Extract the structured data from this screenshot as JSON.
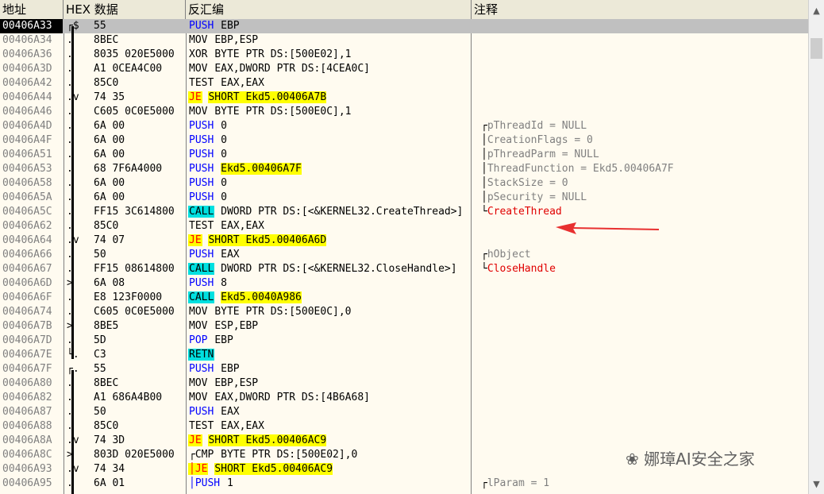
{
  "columns": {
    "address": "地址",
    "hex": "HEX 数据",
    "disassembly": "反汇编",
    "comment": "注释"
  },
  "rows": [
    {
      "addr": "00406A33",
      "mark": "┌$",
      "hex": "55",
      "type": "push",
      "mn": "PUSH",
      "args": "EBP",
      "comment": "",
      "selected": true
    },
    {
      "addr": "00406A34",
      "mark": ".",
      "hex": "8BEC",
      "type": "plain",
      "mn": "MOV",
      "args": "EBP,ESP",
      "comment": ""
    },
    {
      "addr": "00406A36",
      "mark": ".",
      "hex": "8035 020E5000",
      "type": "plain",
      "mn": "XOR",
      "args": "BYTE PTR DS:[500E02],1",
      "comment": ""
    },
    {
      "addr": "00406A3D",
      "mark": ".",
      "hex": "A1 0CEA4C00",
      "type": "plain",
      "mn": "MOV",
      "args": "EAX,DWORD PTR DS:[4CEA0C]",
      "comment": ""
    },
    {
      "addr": "00406A42",
      "mark": ".",
      "hex": "85C0",
      "type": "plain",
      "mn": "TEST",
      "args": "EAX,EAX",
      "comment": ""
    },
    {
      "addr": "00406A44",
      "mark": ".v",
      "hex": "74 35",
      "type": "jcc",
      "mn": "JE",
      "args": "SHORT Ekd5.00406A7B",
      "comment": ""
    },
    {
      "addr": "00406A46",
      "mark": ".",
      "hex": "C605 0C0E5000",
      "type": "plain",
      "mn": "MOV",
      "args": "BYTE PTR DS:[500E0C],1",
      "comment": ""
    },
    {
      "addr": "00406A4D",
      "mark": ".",
      "hex": "6A 00",
      "type": "push",
      "mn": "PUSH",
      "args": "0",
      "comment": "pThreadId = NULL",
      "cb": "┌"
    },
    {
      "addr": "00406A4F",
      "mark": ".",
      "hex": "6A 00",
      "type": "push",
      "mn": "PUSH",
      "args": "0",
      "comment": "CreationFlags = 0",
      "cb": "│"
    },
    {
      "addr": "00406A51",
      "mark": ".",
      "hex": "6A 00",
      "type": "push",
      "mn": "PUSH",
      "args": "0",
      "comment": "pThreadParm = NULL",
      "cb": "│"
    },
    {
      "addr": "00406A53",
      "mark": ".",
      "hex": "68 7F6A4000",
      "type": "push",
      "mn": "PUSH",
      "args": "Ekd5.00406A7F",
      "hlArgs": true,
      "comment": "ThreadFunction = Ekd5.00406A7F",
      "cb": "│"
    },
    {
      "addr": "00406A58",
      "mark": ".",
      "hex": "6A 00",
      "type": "push",
      "mn": "PUSH",
      "args": "0",
      "comment": "StackSize = 0",
      "cb": "│"
    },
    {
      "addr": "00406A5A",
      "mark": ".",
      "hex": "6A 00",
      "type": "push",
      "mn": "PUSH",
      "args": "0",
      "comment": "pSecurity = NULL",
      "cb": "│"
    },
    {
      "addr": "00406A5C",
      "mark": ".",
      "hex": "FF15 3C614800",
      "type": "call",
      "mn": "CALL",
      "args": "DWORD PTR DS:[<&KERNEL32.CreateThread>]",
      "comment": "CreateThread",
      "red": true,
      "cb": "└"
    },
    {
      "addr": "00406A62",
      "mark": ".",
      "hex": "85C0",
      "type": "plain",
      "mn": "TEST",
      "args": "EAX,EAX",
      "comment": ""
    },
    {
      "addr": "00406A64",
      "mark": ".v",
      "hex": "74 07",
      "type": "jcc",
      "mn": "JE",
      "args": "SHORT Ekd5.00406A6D",
      "comment": ""
    },
    {
      "addr": "00406A66",
      "mark": ".",
      "hex": "50",
      "type": "push",
      "mn": "PUSH",
      "args": "EAX",
      "comment": "hObject",
      "cb": "┌"
    },
    {
      "addr": "00406A67",
      "mark": ".",
      "hex": "FF15 08614800",
      "type": "call",
      "mn": "CALL",
      "args": "DWORD PTR DS:[<&KERNEL32.CloseHandle>]",
      "comment": "CloseHandle",
      "red": true,
      "cb": "└"
    },
    {
      "addr": "00406A6D",
      "mark": ">",
      "hex": "6A 08",
      "type": "push",
      "mn": "PUSH",
      "args": "8",
      "comment": ""
    },
    {
      "addr": "00406A6F",
      "mark": ".",
      "hex": "E8 123F0000",
      "type": "call",
      "mn": "CALL",
      "args": "Ekd5.0040A986",
      "hlArgs": true,
      "comment": ""
    },
    {
      "addr": "00406A74",
      "mark": ".",
      "hex": "C605 0C0E5000",
      "type": "plain",
      "mn": "MOV",
      "args": "BYTE PTR DS:[500E0C],0",
      "comment": ""
    },
    {
      "addr": "00406A7B",
      "mark": ">",
      "hex": "8BE5",
      "type": "plain",
      "mn": "MOV",
      "args": "ESP,EBP",
      "comment": ""
    },
    {
      "addr": "00406A7D",
      "mark": ".",
      "hex": "5D",
      "type": "pop",
      "mn": "POP",
      "args": "EBP",
      "comment": ""
    },
    {
      "addr": "00406A7E",
      "mark": "└.",
      "hex": "C3",
      "type": "retn",
      "mn": "RETN",
      "args": "",
      "comment": ""
    },
    {
      "addr": "00406A7F",
      "mark": "┌.",
      "hex": "55",
      "type": "push",
      "mn": "PUSH",
      "args": "EBP",
      "comment": ""
    },
    {
      "addr": "00406A80",
      "mark": ".",
      "hex": "8BEC",
      "type": "plain",
      "mn": "MOV",
      "args": "EBP,ESP",
      "comment": ""
    },
    {
      "addr": "00406A82",
      "mark": ".",
      "hex": "A1 686A4B00",
      "type": "plain",
      "mn": "MOV",
      "args": "EAX,DWORD PTR DS:[4B6A68]",
      "comment": ""
    },
    {
      "addr": "00406A87",
      "mark": ".",
      "hex": "50",
      "type": "push",
      "mn": "PUSH",
      "args": "EAX",
      "comment": ""
    },
    {
      "addr": "00406A88",
      "mark": ".",
      "hex": "85C0",
      "type": "plain",
      "mn": "TEST",
      "args": "EAX,EAX",
      "comment": ""
    },
    {
      "addr": "00406A8A",
      "mark": ".v",
      "hex": "74 3D",
      "type": "jcc",
      "mn": "JE",
      "args": "SHORT Ekd5.00406AC9",
      "comment": ""
    },
    {
      "addr": "00406A8C",
      "mark": ">",
      "hex": "803D 020E5000",
      "type": "plain",
      "mn": "┌CMP",
      "args": "BYTE PTR DS:[500E02],0",
      "comment": ""
    },
    {
      "addr": "00406A93",
      "mark": ".v",
      "hex": "74 34",
      "type": "jcc",
      "mn": "│JE",
      "args": "SHORT Ekd5.00406AC9",
      "comment": ""
    },
    {
      "addr": "00406A95",
      "mark": ".",
      "hex": "6A 01",
      "type": "push",
      "mn": "│PUSH",
      "args": "1",
      "comment": "lParam = 1",
      "cb": "┌"
    }
  ],
  "watermark": "娜璋AI安全之家",
  "icons": {
    "scroll_up": "scroll-up-icon",
    "scroll_down": "scroll-down-icon",
    "arrow": "red-arrow-icon",
    "wechat": "wechat-icon"
  }
}
